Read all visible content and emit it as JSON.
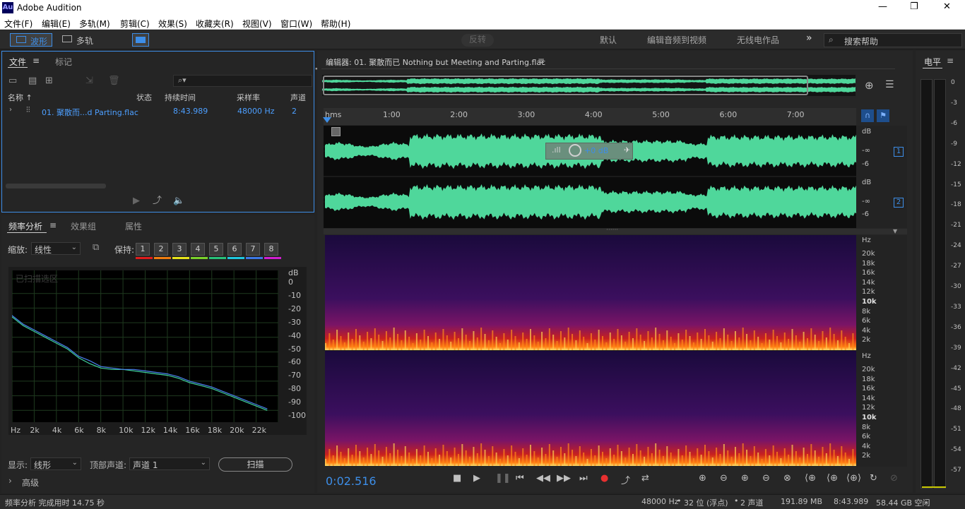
{
  "window": {
    "app_icon": "Au",
    "title": "Adobe Audition",
    "controls": [
      "—",
      "❐",
      "✕"
    ]
  },
  "menu": [
    "文件(F)",
    "编辑(E)",
    "多轨(M)",
    "剪辑(C)",
    "效果(S)",
    "收藏夹(R)",
    "视图(V)",
    "窗口(W)",
    "帮助(H)"
  ],
  "toolbar": {
    "mode_waveform": "波形",
    "mode_multitrack": "多轨",
    "reverse_label": "反转",
    "workspaces": [
      "默认",
      "编辑音频到视频",
      "无线电作品"
    ],
    "more": "»",
    "search_placeholder": "搜索帮助"
  },
  "files_panel": {
    "tabs": [
      "文件",
      "标记"
    ],
    "menu_icon": "≡",
    "columns": [
      "名称 ↑",
      "状态",
      "持续时间",
      "采样率",
      "声道"
    ],
    "rows": [
      {
        "name": "01. 聚散而...d Parting.flac",
        "status": "",
        "duration": "8:43.989",
        "sample_rate": "48000 Hz",
        "channels": "2"
      }
    ]
  },
  "freq_panel": {
    "tabs": [
      "频率分析",
      "效果组",
      "属性"
    ],
    "zoom_label": "缩放:",
    "zoom_value": "线性",
    "keep_label": "保持:",
    "keep_slots": [
      "1",
      "2",
      "3",
      "4",
      "5",
      "6",
      "7",
      "8"
    ],
    "keep_colors": [
      "#e01c1c",
      "#f07d0f",
      "#e8e41a",
      "#7ad22a",
      "#27c27a",
      "#1ec8e0",
      "#3c78e6",
      "#d21ed2"
    ],
    "graph_placeholder": "已扫描选区",
    "db_axis": [
      "dB",
      "0",
      "-10",
      "-20",
      "-30",
      "-40",
      "-50",
      "-60",
      "-70",
      "-80",
      "-90",
      "-100"
    ],
    "hz_axis": [
      "Hz",
      "2k",
      "4k",
      "6k",
      "8k",
      "10k",
      "12k",
      "14k",
      "16k",
      "18k",
      "20k",
      "22k"
    ],
    "display_label": "显示:",
    "display_value": "线形",
    "top_channel_label": "顶部声道:",
    "top_channel_value": "声道 1",
    "scan_button": "扫描",
    "advanced_label": "高级"
  },
  "editor": {
    "title": "编辑器: 01. 聚散而已 Nothing but Meeting and Parting.flac",
    "menu_icon": "≡",
    "ruler_unit": "hms",
    "ruler_ticks": [
      "1:00",
      "2:00",
      "3:00",
      "4:00",
      "5:00",
      "6:00",
      "7:00"
    ],
    "hud_gain": "+0 dB",
    "db_labels": [
      "dB",
      "-∞",
      "-6"
    ],
    "channels": [
      "1",
      "2"
    ],
    "hz_labels": [
      "Hz",
      "20k",
      "18k",
      "16k",
      "14k",
      "12k",
      "10k",
      "8k",
      "6k",
      "4k",
      "2k"
    ],
    "time_display": "0:02.516"
  },
  "level_meter": {
    "title": "电平",
    "menu_icon": "≡",
    "ticks": [
      "0",
      "-3",
      "-6",
      "-9",
      "-12",
      "-15",
      "-18",
      "-21",
      "-24",
      "-27",
      "-30",
      "-33",
      "-36",
      "-39",
      "-42",
      "-45",
      "-48",
      "-51",
      "-54",
      "-57"
    ]
  },
  "status": {
    "left": "频率分析 完成用时 14.75 秒",
    "sample_rate": "48000 Hz",
    "bit_depth": "32 位 (浮点)",
    "channels": "2 声道",
    "file_size": "191.89 MB",
    "duration": "8:43.989",
    "free_space": "58.44 GB 空闲"
  },
  "chart_data": {
    "type": "line",
    "xlabel": "Hz",
    "ylabel": "dB",
    "xlim": [
      0,
      24000
    ],
    "ylim": [
      -100,
      0
    ],
    "x": [
      0,
      1000,
      2000,
      3000,
      4000,
      5000,
      6000,
      7000,
      8000,
      9000,
      10000,
      11000,
      12000,
      13000,
      14000,
      15000,
      16000,
      17000,
      18000,
      19000,
      20000,
      21000,
      22000,
      23000
    ],
    "series": [
      {
        "values": [
          -26,
          -32,
          -36,
          -40,
          -44,
          -48,
          -54,
          -58,
          -61,
          -62,
          -62,
          -63,
          -64,
          -65,
          -66,
          -68,
          -71,
          -73,
          -75,
          -78,
          -81,
          -84,
          -87,
          -90
        ]
      },
      {
        "values": [
          -25,
          -31,
          -35,
          -39,
          -43,
          -47,
          -53,
          -56,
          -60,
          -61,
          -62,
          -62,
          -63,
          -64,
          -65,
          -67,
          -70,
          -72,
          -74,
          -77,
          -80,
          -83,
          -86,
          -89
        ]
      }
    ],
    "colors": [
      "#3fd19b",
      "#4a7ff0"
    ]
  }
}
